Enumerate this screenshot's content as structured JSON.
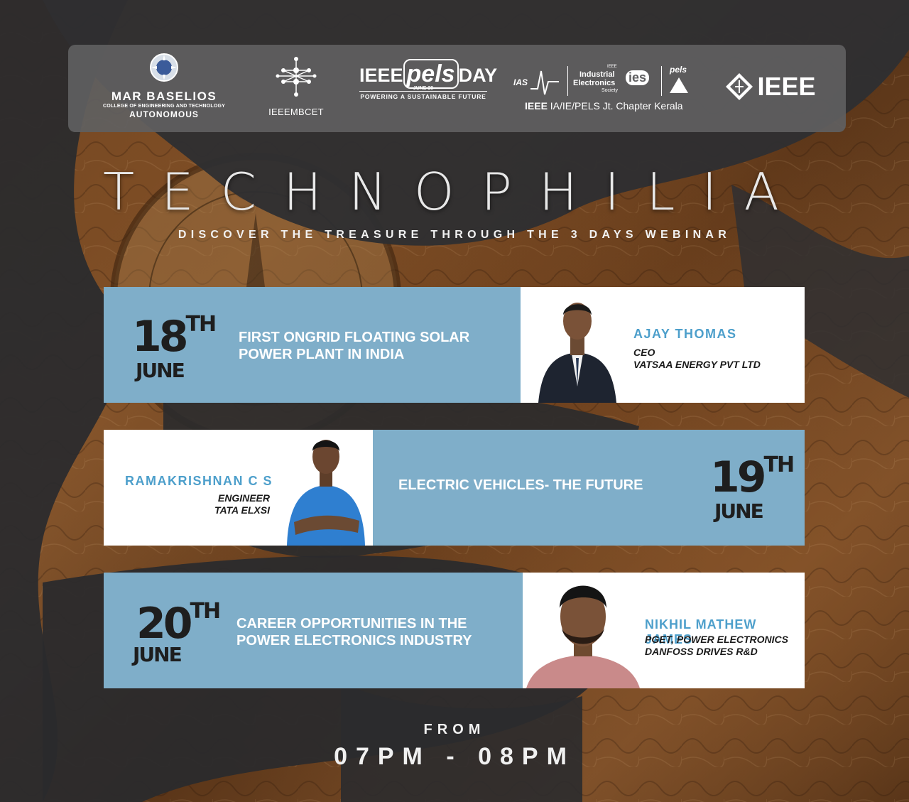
{
  "logos": {
    "college_line1": "MAR BASELIOS",
    "college_line2": "COLLEGE OF ENGINEERING AND TECHNOLOGY",
    "college_line3": "AUTONOMOUS",
    "ieeembcet": "IEEEMBCET",
    "pels_day_left": "IEEE",
    "pels_day_mid": "pels",
    "pels_day_right": "DAY",
    "pels_day_date": "JUNE 20",
    "pels_day_tag": "POWERING A SUSTAINABLE FUTURE",
    "ias_label": "IAS",
    "ie_small": "IEEE",
    "ie_line1": "Industrial",
    "ie_line2": "Electronics",
    "ie_line3": "Society",
    "ies_label": "ies",
    "pels_label": "pels",
    "chapter_bold": "IEEE",
    "chapter_rest": "IA/IE/PELS Jt. Chapter Kerala",
    "ieee": "IEEE"
  },
  "title": "TECHNOPHILIA",
  "subtitle": "DISCOVER THE TREASURE THROUGH THE 3 DAYS WEBINAR",
  "sessions": [
    {
      "date_num": "18",
      "date_sup": "TH",
      "month": "JUNE",
      "talk_line1": "FIRST ONGRID FLOATING SOLAR",
      "talk_line2": "POWER PLANT IN INDIA",
      "speaker": "AJAY THOMAS",
      "role_line1": "CEO",
      "role_line2": "VATSAA ENERGY PVT LTD"
    },
    {
      "date_num": "19",
      "date_sup": "TH",
      "month": "JUNE",
      "talk_line1": "ELECTRIC VEHICLES- THE FUTURE",
      "speaker": "RAMAKRISHNAN C S",
      "role_line1": "ENGINEER",
      "role_line2": "TATA ELXSI"
    },
    {
      "date_num": "20",
      "date_sup": "TH",
      "month": "JUNE",
      "talk_line1": "CAREER OPPORTUNITIES IN THE",
      "talk_line2": "POWER ELECTRONICS INDUSTRY",
      "speaker": "NIKHIL MATHEW JAMES",
      "role_line1": "PGET, POWER ELECTRONICS",
      "role_line2": "DANFOSS DRIVES R&D"
    }
  ],
  "from_label": "FROM",
  "time_range": "07PM - 08PM",
  "colors": {
    "card_blue": "#7faec9",
    "speaker_name": "#4d9fcb",
    "dark_wave": "#2b2b2d"
  }
}
